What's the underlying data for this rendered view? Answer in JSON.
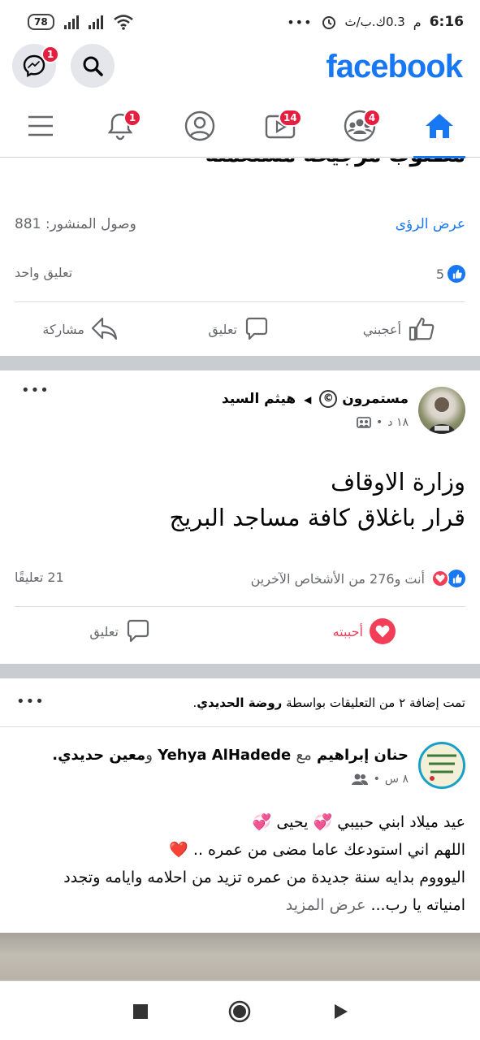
{
  "status": {
    "time": "6:16",
    "ampm": "م",
    "speed": "0.3ك.ب/ث",
    "dots": "•••",
    "battery": "78"
  },
  "header": {
    "logo": "facebook",
    "messenger_badge": "1"
  },
  "tabs": {
    "notifications_badge": "1",
    "watch_badge": "14",
    "groups_badge": "4"
  },
  "post1": {
    "cut_title": "مطلوب مرجيحة مستعملة",
    "insights_link": "عرض الرؤى",
    "reach_label": "وصول المنشور:",
    "reach_value": "881",
    "reactions_count": "5",
    "comments_text": "تعليق واحد",
    "like_label": "أعجبني",
    "comment_label": "تعليق",
    "share_label": "مشاركة"
  },
  "post2": {
    "group_name": "مستمرون",
    "author": "هيثم السيد",
    "time": "١٨ د",
    "line1": "وزارة الاوقاف",
    "line2": "قرار باغلاق كافة مساجد البريج",
    "reactions_text": "أنت و276 من الأشخاص الآخرين",
    "comments_count": "21 تعليقًا",
    "loved_label": "أحببته",
    "comment_label": "تعليق",
    "more": "•••"
  },
  "post3": {
    "added_prefix": "تمت إضافة ٢ من التعليقات بواسطة",
    "added_by": "روضة الحديدي",
    "author": "حنان إبراهيم",
    "with_word": "مع",
    "tag1": "Yehya AlHadede",
    "and_word": "و",
    "tag2": "معين حديدي",
    "time": "٨ س",
    "line1": "عيد ميلاد ابني حبيبي 💞 يحيى 💞",
    "line2": "اللهم اني استودعك عاما مضى من عمره .. ❤️",
    "line3": "اليوووم بدايه سنة جديدة من عمره تزيد من احلامه وايامه وتجدد",
    "line4": "امنياته يا رب...",
    "see_more": "عرض المزيد",
    "more": "•••"
  },
  "colors": {
    "brand": "#1877f2",
    "badge": "#e41e3f",
    "love": "#f33e58"
  }
}
